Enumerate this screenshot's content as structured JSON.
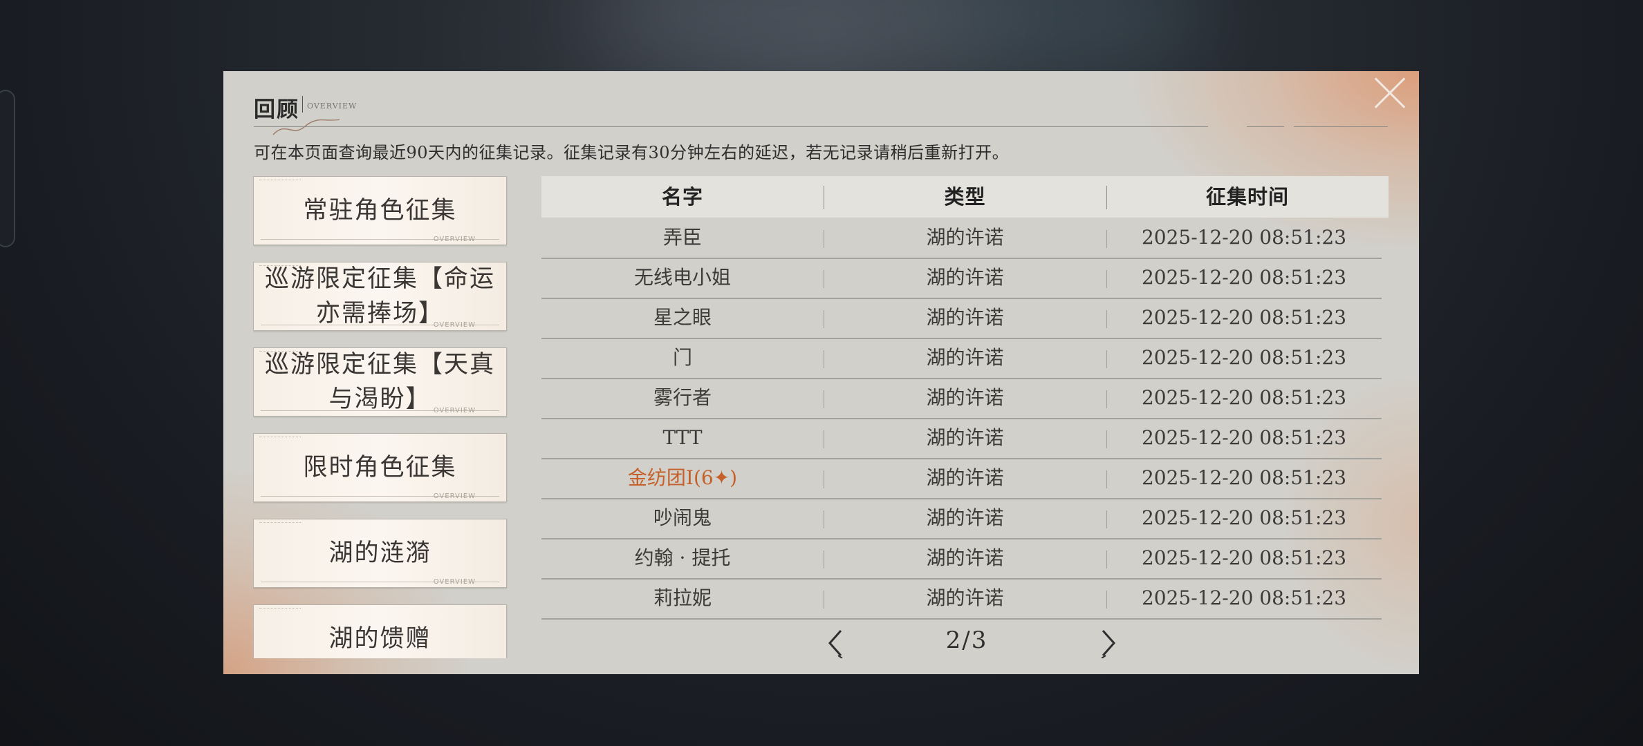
{
  "header": {
    "title": "回顾",
    "subtitle": "OVERVIEW",
    "description": "可在本页面查询最近90天内的征集记录。征集记录有30分钟左右的延迟，若无记录请稍后重新打开。"
  },
  "sidebar": {
    "items": [
      {
        "label": "常驻角色征集"
      },
      {
        "label": "巡游限定征集【命运亦需捧场】"
      },
      {
        "label": "巡游限定征集【天真与渴盼】"
      },
      {
        "label": "限时角色征集"
      },
      {
        "label": "湖的涟漪"
      },
      {
        "label": "湖的馈赠"
      }
    ],
    "card_footer": "OVERVIEW"
  },
  "table": {
    "columns": [
      "名字",
      "类型",
      "征集时间"
    ],
    "rows": [
      {
        "name": "弄臣",
        "type": "湖的许诺",
        "time": "2025-12-20 08:51:23"
      },
      {
        "name": "无线电小姐",
        "type": "湖的许诺",
        "time": "2025-12-20 08:51:23"
      },
      {
        "name": "星之眼",
        "type": "湖的许诺",
        "time": "2025-12-20 08:51:23"
      },
      {
        "name": "门",
        "type": "湖的许诺",
        "time": "2025-12-20 08:51:23"
      },
      {
        "name": "雾行者",
        "type": "湖的许诺",
        "time": "2025-12-20 08:51:23"
      },
      {
        "name": "TTT",
        "type": "湖的许诺",
        "time": "2025-12-20 08:51:23"
      },
      {
        "name": "金纺团I(6✦)",
        "type": "湖的许诺",
        "time": "2025-12-20 08:51:23",
        "rare": true
      },
      {
        "name": "吵闹鬼",
        "type": "湖的许诺",
        "time": "2025-12-20 08:51:23"
      },
      {
        "name": "约翰 · 提托",
        "type": "湖的许诺",
        "time": "2025-12-20 08:51:23"
      },
      {
        "name": "莉拉妮",
        "type": "湖的许诺",
        "time": "2025-12-20 08:51:23"
      }
    ]
  },
  "pagination": {
    "current": "2/3"
  },
  "icons": {
    "close": "close-icon",
    "prev": "chevron-left-icon",
    "next": "chevron-right-icon"
  },
  "colors": {
    "accent_rare": "#c5602a",
    "panel_bg": "#d1d0ca",
    "glow": "#de966e"
  }
}
